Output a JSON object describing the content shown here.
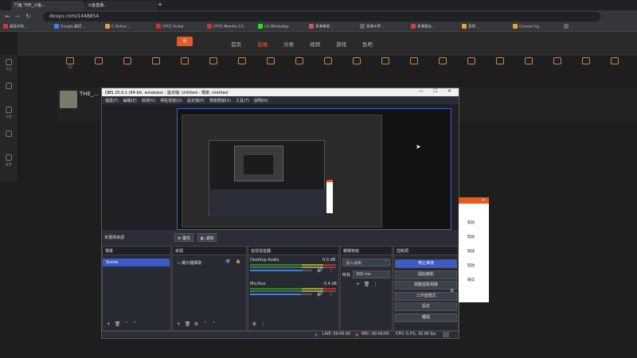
{
  "browser": {
    "tabs": [
      "鬥鱼 THE_斗鱼...",
      "斗鱼直播..."
    ],
    "url": "douyu.com/1448854"
  },
  "bookmarks": [
    {
      "label": "超级冲突...",
      "color": "#d33"
    },
    {
      "label": "Google 翻译 ...",
      "color": "#4a7cf6"
    },
    {
      "label": "C Online ...",
      "color": "#e6a23c"
    },
    {
      "label": "CPCE Portal",
      "color": "#c33"
    },
    {
      "label": "CPCE Moodle 3.5",
      "color": "#c33"
    },
    {
      "label": "(1) WhatsApp",
      "color": "#2d2"
    },
    {
      "label": "香港專業...",
      "color": "#c55"
    },
    {
      "label": "香港大學...",
      "color": "#666"
    },
    {
      "label": "香港電台...",
      "color": "#c44"
    },
    {
      "label": "政府 ...",
      "color": "#e6a23c"
    },
    {
      "label": "Convert kg...",
      "color": "#e6a23c"
    },
    {
      "label": "...",
      "color": "#666"
    }
  ],
  "site": {
    "nav": [
      "首页",
      "直播",
      "分类",
      "视频",
      "游戏",
      "鱼吧"
    ],
    "categories": [
      "12",
      "",
      "",
      "",
      "",
      "",
      "",
      "",
      "",
      "",
      "",
      "",
      "",
      "",
      "",
      "",
      "",
      "",
      "",
      ""
    ],
    "streamer_name": "THE_...",
    "left_nav": [
      "关注",
      "",
      "分类",
      "",
      "推荐"
    ]
  },
  "obs": {
    "title": "OBS 25.0.1 (64-bit, windows) - 設定檔: Untitled - 場景: Untitled",
    "menu": [
      "檔案(F)",
      "編輯(E)",
      "檢視(V)",
      "停駐視窗(D)",
      "設定檔(P)",
      "場景群組(S)",
      "工具(T)",
      "說明(H)"
    ],
    "toolbar": {
      "no_source": "未選擇來源",
      "properties": "屬性",
      "filters": "濾鏡"
    },
    "docks": {
      "scenes": {
        "title": "場景",
        "items": [
          "Scene"
        ]
      },
      "sources": {
        "title": "來源",
        "items": [
          "顯示器擷取"
        ]
      },
      "mixer": {
        "title": "音效混音器",
        "tracks": [
          {
            "name": "Desktop Audio",
            "db": "0.0 dB",
            "level": 0.85
          },
          {
            "name": "Mic/Aux",
            "db": "-3.4 dB",
            "level": 0.82
          }
        ]
      },
      "transitions": {
        "title": "轉場特效",
        "type": "淡入淡出",
        "duration_label": "時長",
        "duration": "300 ms"
      },
      "controls": {
        "title": "控制項",
        "buttons": [
          "停止串流",
          "開始錄影",
          "啟動虛擬相機",
          "工作室模式",
          "設定",
          "離開"
        ]
      }
    },
    "status": {
      "live": "LIVE: 00:00:00",
      "rec": "REC: 00:00:00",
      "cpu": "CPU: 0.5%, 30.00 fps"
    }
  },
  "side_window": {
    "labels": [
      "開啟",
      "開啟",
      "開啟",
      "開啟",
      "確認"
    ]
  }
}
